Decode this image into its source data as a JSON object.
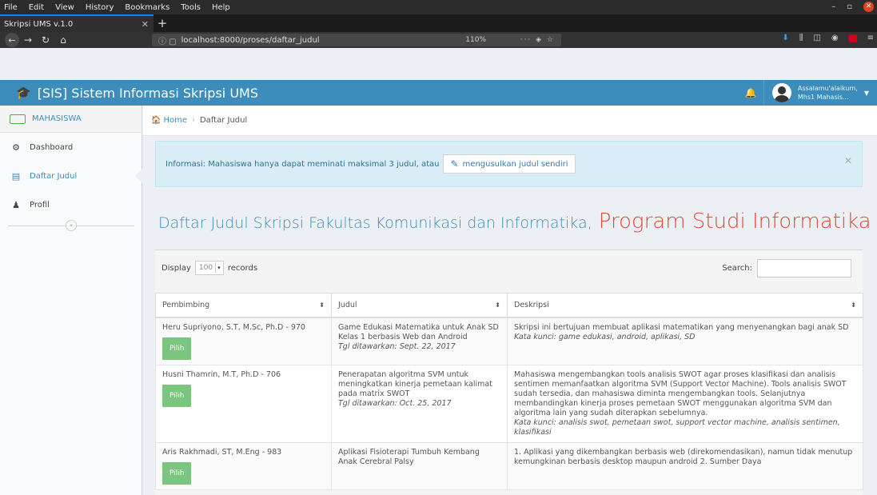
{
  "browser": {
    "menu": [
      "File",
      "Edit",
      "View",
      "History",
      "Bookmarks",
      "Tools",
      "Help"
    ],
    "tab_title": "Skripsi UMS v.1.0",
    "url": "localhost:8000/proses/daftar_judul",
    "zoom": "110%"
  },
  "app": {
    "brand": "[SIS] Sistem Informasi Skripsi UMS",
    "user_greeting": "Assalamu'alaikum,",
    "user_name": "Mhs1 Mahasis..."
  },
  "sidebar": {
    "header": "MAHASISWA",
    "items": [
      {
        "label": "Dashboard",
        "icon": "dashboard-icon"
      },
      {
        "label": "Daftar Judul",
        "icon": "list-icon"
      },
      {
        "label": "Profil",
        "icon": "user-icon"
      }
    ]
  },
  "breadcrumb": {
    "home": "Home",
    "current": "Daftar Judul"
  },
  "alert": {
    "text": "Informasi: Mahasiswa hanya dapat meminati maksimal 3 judul, atau",
    "button": "mengusulkan judul sendiri"
  },
  "heading": {
    "main": "Daftar Judul Skripsi Fakultas Komunikasi dan Informatika,",
    "prodi": "Program Studi Informatika"
  },
  "table_controls": {
    "display_label": "Display",
    "display_value": "100",
    "records_label": "records",
    "search_label": "Search:"
  },
  "table": {
    "headers": [
      "Pembimbing",
      "Judul",
      "Deskripsi"
    ],
    "pilih_label": "Pilih",
    "rows": [
      {
        "pembimbing": "Heru Supriyono, S.T, M.Sc, Ph.D - 970",
        "judul": "Game Edukasi Matematika untuk Anak SD Kelas 1 berbasis Web dan Android",
        "tgl": "Tgl ditawarkan: Sept. 22, 2017",
        "deskripsi": "Skripsi ini bertujuan membuat aplikasi matematikan yang menyenangkan bagi anak SD",
        "kata_kunci": "Kata kunci: game edukasi, android, aplikasi, SD"
      },
      {
        "pembimbing": "Husni Thamrin, M.T, Ph.D - 706",
        "judul": "Penerapatan algoritma SVM untuk meningkatkan kinerja pemetaan kalimat pada matrix SWOT",
        "tgl": "Tgl ditawarkan: Oct. 25, 2017",
        "deskripsi": "Mahasiswa mengembangkan tools analisis SWOT agar proses klasifikasi dan analisis sentimen memanfaatkan algoritma SVM (Support Vector Machine). Tools analisis SWOT sudah tersedia, dan mahasiswa diminta mengembangkan tools. Selanjutnya membandingkan kinerja proses pemetaan SWOT menggunakan algoritma SVM dan algoritma lain yang sudah diterapkan sebelumnya.",
        "kata_kunci": "Kata kunci: analisis swot, pemetaan swot, support vector machine, analisis sentimen, klasifikasi"
      },
      {
        "pembimbing": "Aris Rakhmadi, ST, M.Eng - 983",
        "judul": "Aplikasi Fisioterapi Tumbuh Kembang Anak Cerebral Palsy",
        "tgl": "",
        "deskripsi": "1. Aplikasi yang dikembangkan berbasis web (direkomendasikan), namun tidak menutup kemungkinan berbasis desktop maupun android 2. Sumber Daya",
        "kata_kunci": ""
      }
    ]
  }
}
